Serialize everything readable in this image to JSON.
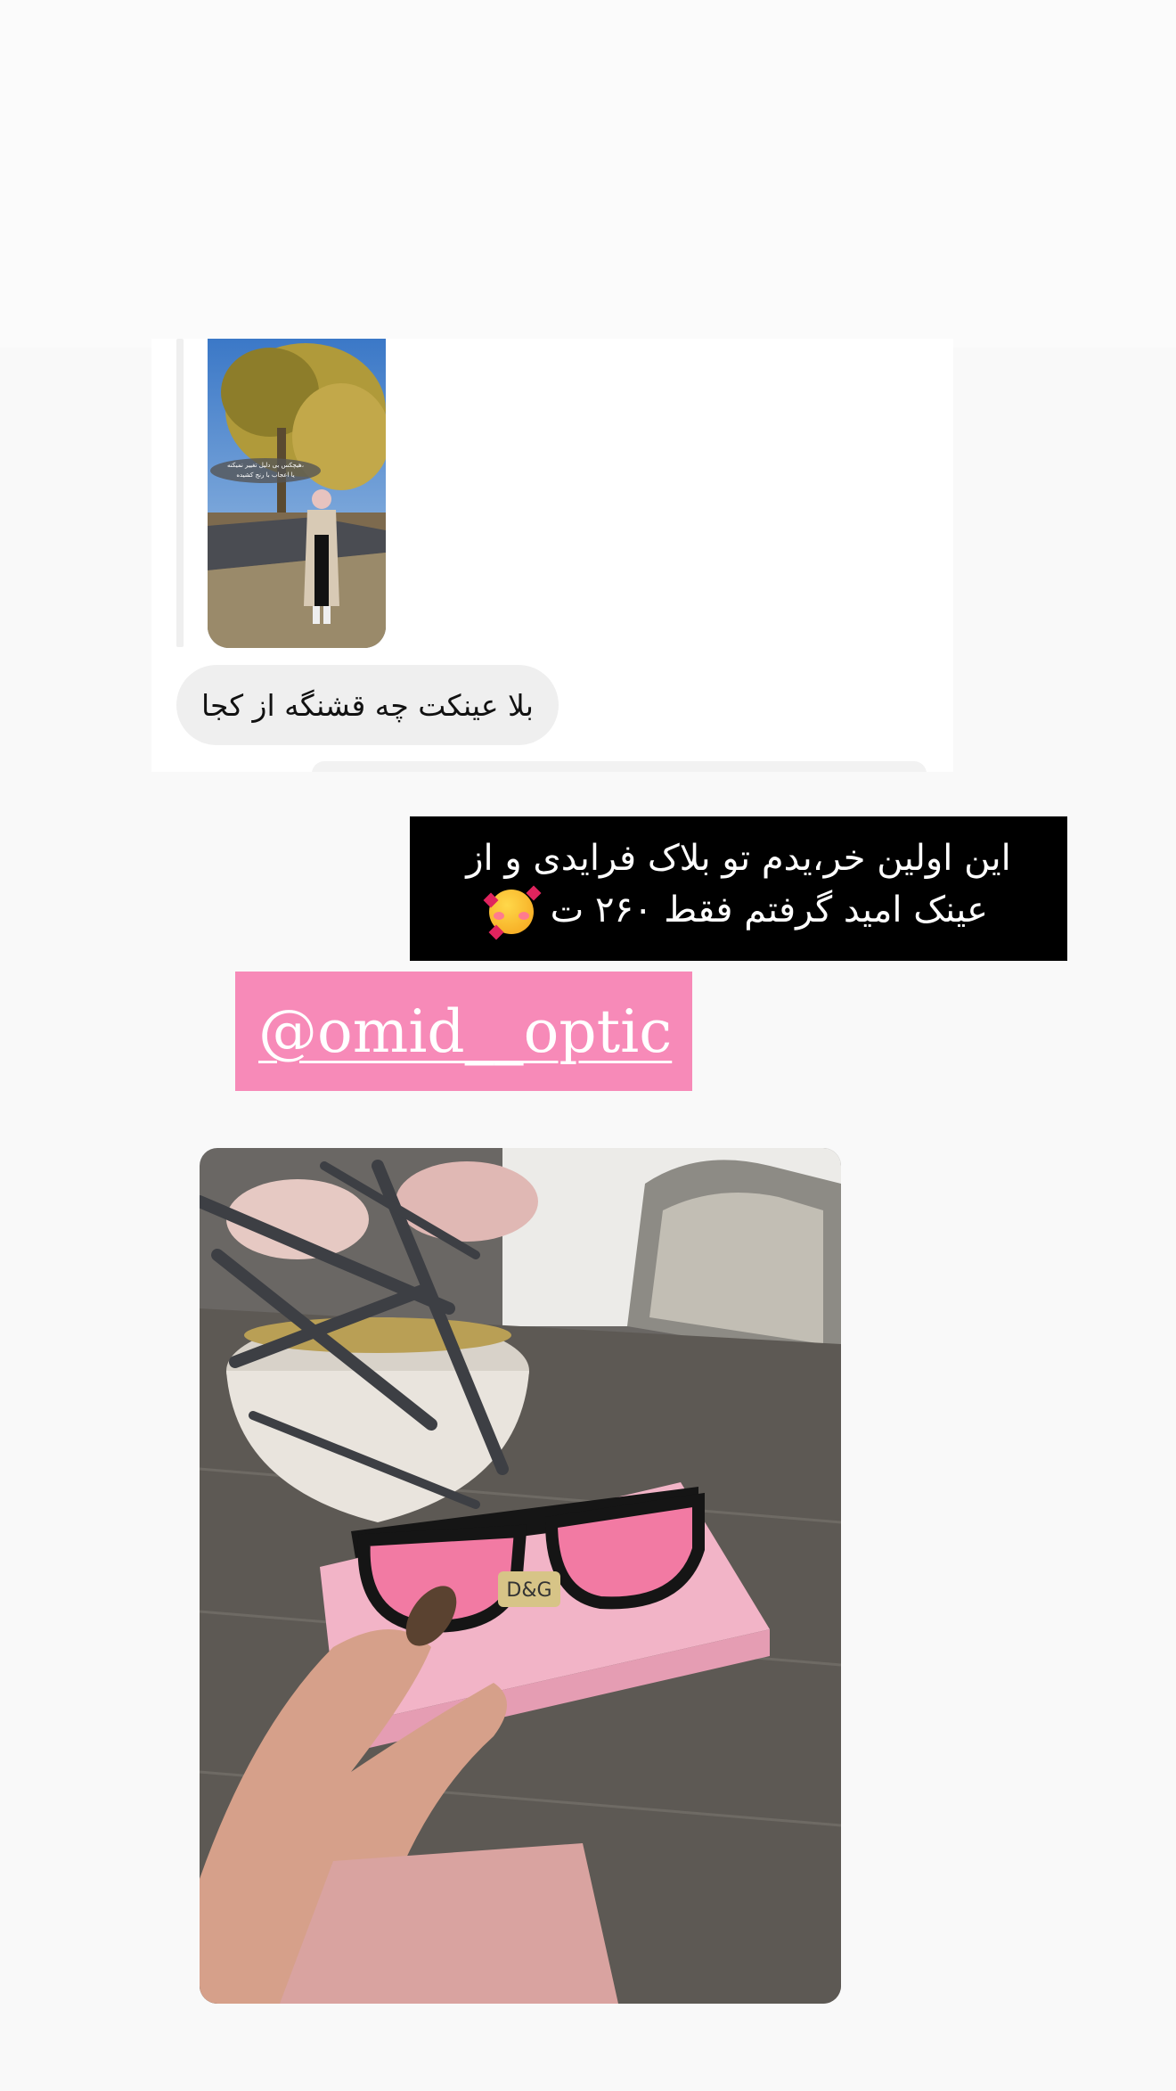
{
  "reply_message": {
    "story_thumbnail_icon": "story-preview-image",
    "story_overlay_text": [
      "هیچکس بی دلیل تغییر نمیکنه،",
      "یا اعجاب با رنج کشیده"
    ],
    "text": "بلا عینکت چه قشنگه از کجا"
  },
  "caption": {
    "line1": "این اولین خر،یدم تو بلاک فرایدی و از",
    "line2": "عینک امید گرفتم فقط ۲۶۰ ت",
    "emoji": "smiling-face-with-hearts"
  },
  "mention": {
    "handle": "@omid__optic",
    "color": "#f78ab8"
  },
  "product_photo": {
    "icon": "pink-sunglasses-photo",
    "box_label": "D&G"
  }
}
